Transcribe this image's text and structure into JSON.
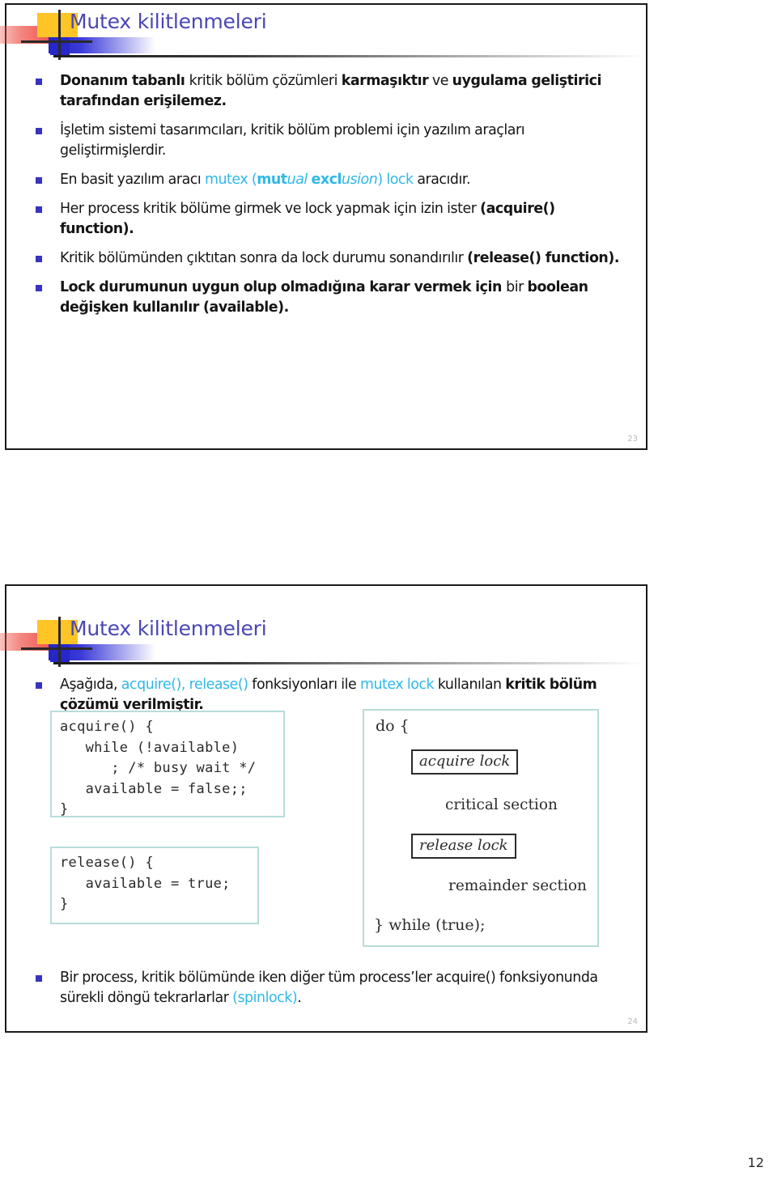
{
  "handout": {
    "page_number": "12"
  },
  "slides": [
    {
      "title": "Mutex kilitlenmeleri",
      "slide_number": "23",
      "bullets": [
        {
          "id": "bullet-hardware-solutions",
          "runs": [
            {
              "text": "Donanım tabanlı ",
              "style": "bold"
            },
            {
              "text": "kritik bölüm çözümleri ",
              "style": "normal"
            },
            {
              "text": "karmaşıktır",
              "style": "bold"
            },
            {
              "text": " ve ",
              "style": "normal"
            },
            {
              "text": "uygulama geliştirici tarafından erişilemez.",
              "style": "bold"
            }
          ]
        },
        {
          "id": "bullet-os-designers",
          "runs": [
            {
              "text": "İşletim sistemi tasarımcıları, kritik bölüm problemi için yazılım araçları geliştirmişlerdir.",
              "style": "normal"
            }
          ]
        },
        {
          "id": "bullet-mutex-lock",
          "runs": [
            {
              "text": "En basit yazılım aracı ",
              "style": "normal"
            },
            {
              "text": "mutex (",
              "style": "cyan"
            },
            {
              "text": "mut",
              "style": "cyan-bold"
            },
            {
              "text": "ual ",
              "style": "cyan-italic"
            },
            {
              "text": "excl",
              "style": "cyan-bold"
            },
            {
              "text": "usion",
              "style": "cyan-italic"
            },
            {
              "text": ") lock",
              "style": "cyan"
            },
            {
              "text": " aracıdır.",
              "style": "normal"
            }
          ]
        },
        {
          "id": "bullet-acquire",
          "runs": [
            {
              "text": "Her process kritik bölüme girmek ve lock yapmak için izin ister ",
              "style": "normal"
            },
            {
              "text": "(acquire() function).",
              "style": "bold"
            }
          ]
        },
        {
          "id": "bullet-release",
          "runs": [
            {
              "text": "Kritik bölümünden çıktıtan sonra da lock durumu sonandırılır ",
              "style": "normal"
            },
            {
              "text": "(release() function).",
              "style": "bold"
            }
          ]
        },
        {
          "id": "bullet-boolean-available",
          "runs": [
            {
              "text": "Lock durumunun uygun olup olmadığına karar vermek için ",
              "style": "bold"
            },
            {
              "text": "bir ",
              "style": "normal"
            },
            {
              "text": "boolean değişken kullanılır (available).",
              "style": "bold"
            }
          ]
        }
      ]
    },
    {
      "title": "Mutex kilitlenmeleri",
      "slide_number": "24",
      "bullets": [
        {
          "id": "bullet-solution-intro",
          "runs": [
            {
              "text": "Aşağıda, ",
              "style": "normal"
            },
            {
              "text": "acquire(), release()",
              "style": "cyan"
            },
            {
              "text": " fonksiyonları ile ",
              "style": "normal"
            },
            {
              "text": "mutex lock",
              "style": "cyan"
            },
            {
              "text": " kullanılan ",
              "style": "normal"
            },
            {
              "text": "kritik bölüm çözümü verilmiştir.",
              "style": "bold"
            }
          ]
        }
      ],
      "bottom_bullets": [
        {
          "id": "bullet-spinlock",
          "runs": [
            {
              "text": "Bir process, kritik bölümünde iken diğer tüm process’ler acquire() fonksiyonunda sürekli döngü tekrarlarlar ",
              "style": "normal"
            },
            {
              "text": "(spinlock)",
              "style": "cyan"
            },
            {
              "text": ".",
              "style": "normal"
            }
          ]
        }
      ],
      "figures": {
        "acquire_code": "acquire() {\n   while (!available)\n      ; /* busy wait */\n   available = false;;\n}",
        "release_code": "release() {\n   available = true;\n}",
        "do_while": {
          "open": "do {",
          "acquire_box": "acquire lock",
          "critical_section": "critical section",
          "release_box": "release lock",
          "remainder_section": "remainder section",
          "close": "} while (true);"
        }
      }
    }
  ],
  "colors": {
    "title": "#4a46b4",
    "bullet_marker": "#3733c0",
    "cyan_accent": "#2fb8e8",
    "figure_border": "#b7ddd9",
    "deco_yellow": "#ffc426",
    "deco_red": "#ee3a32",
    "deco_blue": "#2626c9"
  }
}
